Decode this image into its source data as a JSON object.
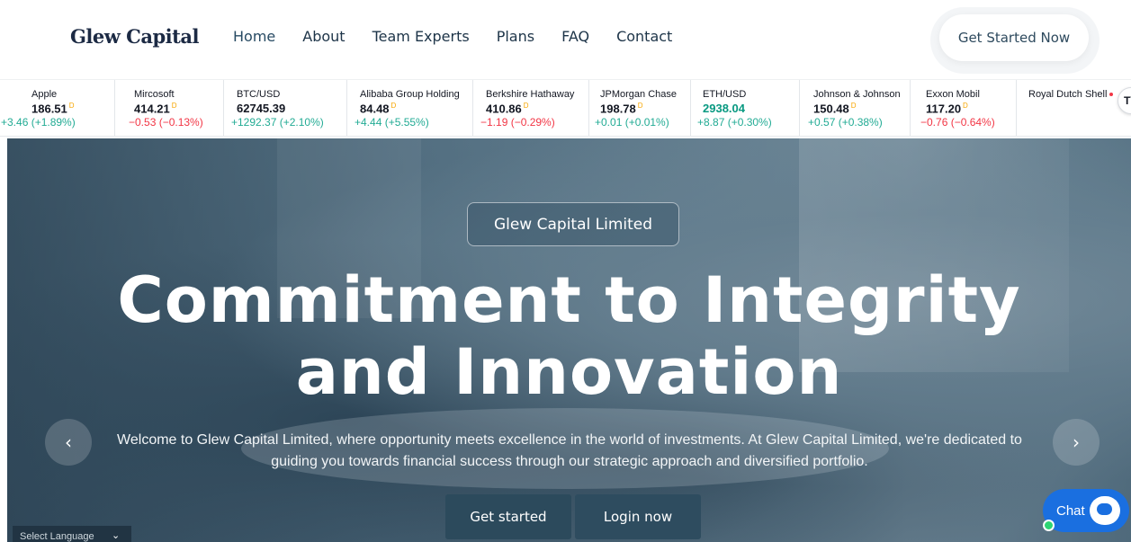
{
  "header": {
    "logo": "Glew Capital",
    "nav": [
      {
        "label": "Home"
      },
      {
        "label": "About"
      },
      {
        "label": "Team Experts"
      },
      {
        "label": "Plans"
      },
      {
        "label": "FAQ"
      },
      {
        "label": "Contact"
      }
    ],
    "cta_label": "Get Started Now"
  },
  "ticker": [
    {
      "name": "Apple",
      "price": "186.51",
      "change": "+3.46 (+1.89%)",
      "direction": "up",
      "flag": "D"
    },
    {
      "name": "Mircosoft",
      "price": "414.21",
      "change": "−0.53 (−0.13%)",
      "direction": "down",
      "flag": "D"
    },
    {
      "name": "BTC/USD",
      "price": "62745.39",
      "change": "+1292.37 (+2.10%)",
      "direction": "up",
      "flag": ""
    },
    {
      "name": "Alibaba Group Holding",
      "price": "84.48",
      "change": "+4.44 (+5.55%)",
      "direction": "up",
      "flag": "D"
    },
    {
      "name": "Berkshire Hathaway",
      "price": "410.86",
      "change": "−1.19 (−0.29%)",
      "direction": "down",
      "flag": "D"
    },
    {
      "name": "JPMorgan Chase",
      "price": "198.78",
      "change": "+0.01 (+0.01%)",
      "direction": "up",
      "flag": "D"
    },
    {
      "name": "ETH/USD",
      "price": "2938.04",
      "change": "+8.87 (+0.30%)",
      "direction": "up",
      "flag": ""
    },
    {
      "name": "Johnson & Johnson",
      "price": "150.48",
      "change": "+0.57 (+0.38%)",
      "direction": "up",
      "flag": "D"
    },
    {
      "name": "Exxon Mobil",
      "price": "117.20",
      "change": "−0.76 (−0.64%)",
      "direction": "down",
      "flag": "D"
    },
    {
      "name": "Royal Dutch Shell",
      "price": "",
      "change": "",
      "direction": "",
      "flag": ""
    }
  ],
  "tv_badge": "TV",
  "hero": {
    "pill": "Glew Capital Limited",
    "headline_line1": "Commitment to Integrity",
    "headline_line2": "and Innovation",
    "subtitle": "Welcome to Glew Capital Limited, where opportunity meets excellence in the world of investments. At Glew Capital Limited, we're dedicated to guiding you towards financial success through our strategic approach and diversified portfolio.",
    "btn_started": "Get started",
    "btn_login": "Login now",
    "prev_icon": "‹",
    "next_icon": "›"
  },
  "language": {
    "label": "Select Language",
    "chevron": "⌄"
  },
  "chat": {
    "label": "Chat"
  },
  "colors": {
    "brand_dark": "#2c4a5c",
    "up": "#22ab94",
    "down": "#f23645",
    "chat": "#1a6fe0"
  }
}
